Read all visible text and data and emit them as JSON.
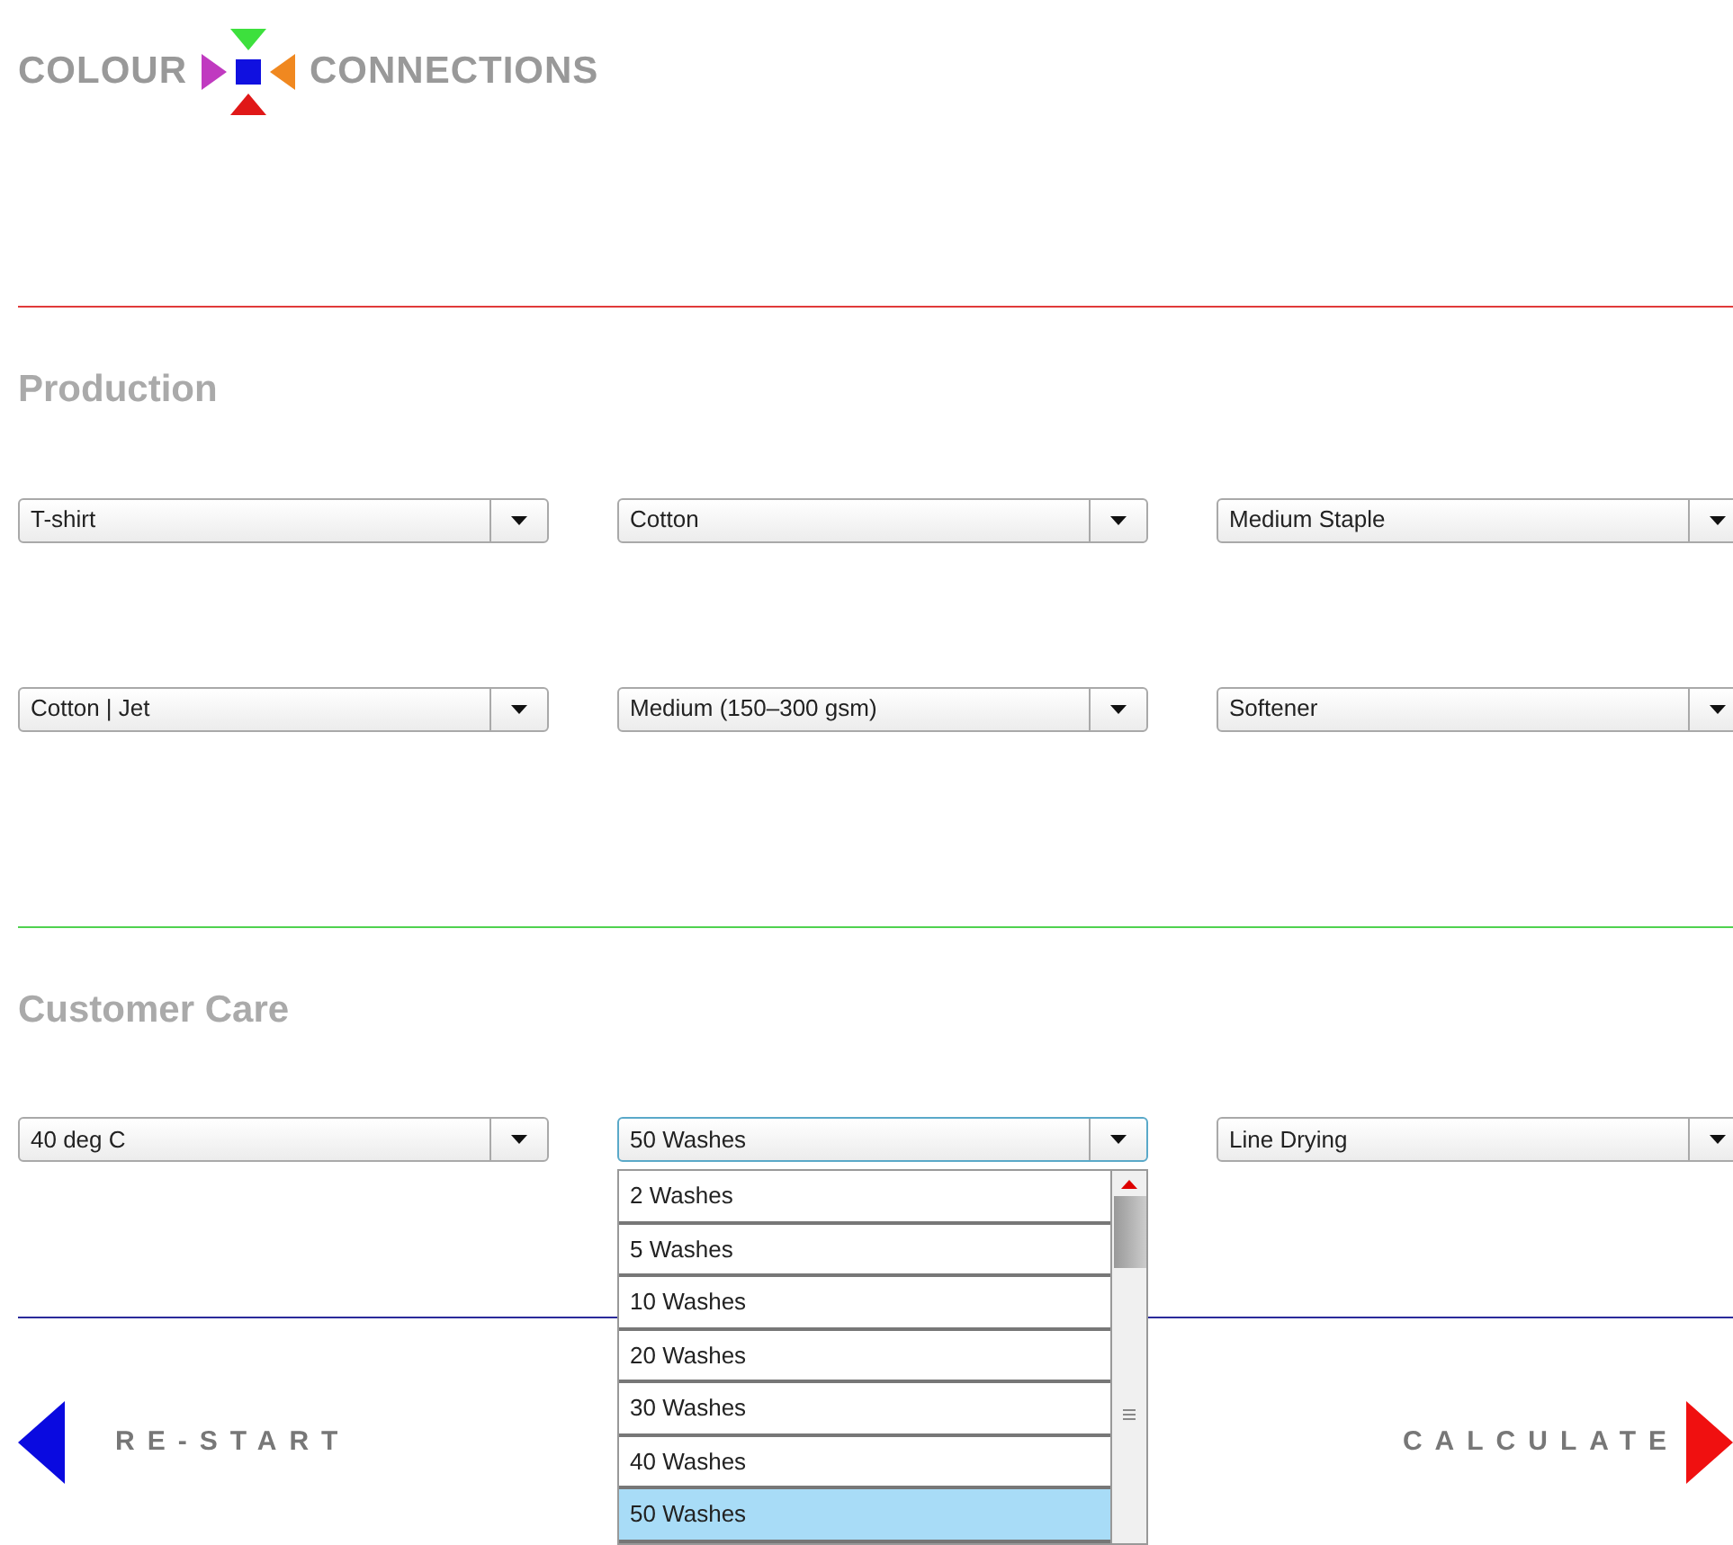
{
  "logo": {
    "left": "COLOUR",
    "right": "CONNECTIONS"
  },
  "sections": [
    {
      "title": "Production",
      "color": "#e03a3a",
      "rows": [
        [
          {
            "value": "T-shirt",
            "open": false
          },
          {
            "value": "Cotton",
            "open": false
          },
          {
            "value": "Medium Staple",
            "open": false
          }
        ],
        [
          {
            "value": "Cotton | Jet",
            "open": false
          },
          {
            "value": "Medium (150–300 gsm)",
            "open": false
          },
          {
            "value": "Softener",
            "open": false
          }
        ]
      ]
    },
    {
      "title": "Customer Care",
      "color": "#4fd24f",
      "rows": [
        [
          {
            "value": "40 deg C",
            "open": false
          },
          {
            "value": "50 Washes",
            "open": true,
            "options": [
              {
                "label": "2 Washes",
                "selected": false
              },
              {
                "label": "5 Washes",
                "selected": false
              },
              {
                "label": "10 Washes",
                "selected": false
              },
              {
                "label": "20 Washes",
                "selected": false
              },
              {
                "label": "30 Washes",
                "selected": false
              },
              {
                "label": "40 Washes",
                "selected": false
              },
              {
                "label": "50 Washes",
                "selected": true
              }
            ]
          },
          {
            "value": "Line Drying",
            "open": false
          }
        ]
      ]
    }
  ],
  "footer": {
    "color": "#2a2a9a",
    "restart": "RE-START",
    "calculate": "CALCULATE"
  }
}
